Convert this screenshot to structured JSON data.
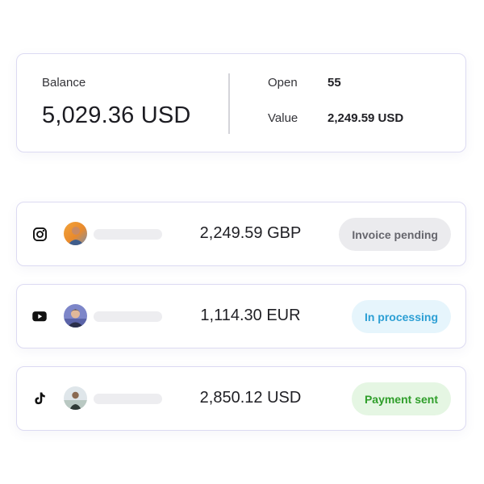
{
  "summary": {
    "balance_label": "Balance",
    "balance_value": "5,029.36 USD",
    "open_label": "Open",
    "open_value": "55",
    "value_label": "Value",
    "value_value": "2,249.59 USD"
  },
  "transactions": [
    {
      "platform_icon": "instagram-icon",
      "amount": "2,249.59 GBP",
      "status": "Invoice pending",
      "status_color": "#ebebee"
    },
    {
      "platform_icon": "youtube-icon",
      "amount": "1,114.30 EUR",
      "status": "In processing",
      "status_color": "#e6f5fc"
    },
    {
      "platform_icon": "tiktok-icon",
      "amount": "2,850.12 USD",
      "status": "Payment sent",
      "status_color": "#e5f6e3"
    }
  ],
  "colors": {
    "card_border": "#dcdaf2",
    "pending_text": "#66666d",
    "processing_text": "#2c9fd4",
    "sent_text": "#2f9e2a"
  }
}
